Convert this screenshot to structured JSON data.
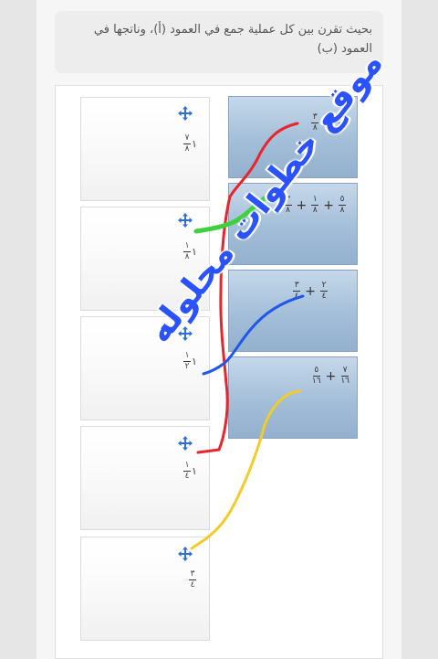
{
  "instruction": "بحيث تقرن بين كل عملية جمع في العمود (أ)، وناتجها في العمود (ب)",
  "column_a": [
    {
      "terms": [
        {
          "num": "٧",
          "den": "٨"
        },
        {
          "num": "٣",
          "den": "٨"
        }
      ],
      "operator": "+"
    },
    {
      "terms": [
        {
          "num": "٥",
          "den": "٨"
        },
        {
          "num": "١",
          "den": "٨"
        },
        {
          "num": "٣",
          "den": "٨"
        }
      ],
      "operator": "+"
    },
    {
      "terms": [
        {
          "num": "٢",
          "den": "٤"
        },
        {
          "num": "٣",
          "den": "٤"
        }
      ],
      "operator": "+"
    },
    {
      "terms": [
        {
          "num": "٧",
          "den": "١٦"
        },
        {
          "num": "٥",
          "den": "١٦"
        }
      ],
      "operator": "+"
    }
  ],
  "column_b": [
    {
      "whole": "١",
      "num": "٧",
      "den": "٨"
    },
    {
      "whole": "١",
      "num": "١",
      "den": "٨"
    },
    {
      "whole": "١",
      "num": "١",
      "den": "٢"
    },
    {
      "whole": "١",
      "num": "١",
      "den": "٤"
    },
    {
      "whole": "",
      "num": "٣",
      "den": "٤"
    }
  ],
  "watermark": "موقع خطوات محلوله",
  "icons": {
    "drag_handle": "move-arrows-icon"
  },
  "colors": {
    "handle": "#2f6fd1",
    "red": "#e8242c",
    "green": "#3dd13d",
    "blue": "#2158e8",
    "yellow": "#f2cc2a",
    "watermark": "#2a52ff"
  }
}
